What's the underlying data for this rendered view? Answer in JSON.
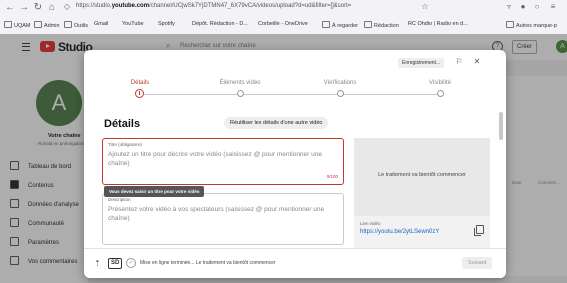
{
  "browser": {
    "url_prefix": "https://studio.",
    "url_domain": "youtube.com",
    "url_path": "/channel/UCjwSk7YjDTMN47_6X79vCA/videos/upload?d=ud&filter=[]&sort=",
    "bookmarks": [
      "UQAM",
      "Admin",
      "Outils",
      "Gmail",
      "YouTube",
      "Spotify",
      "Dépôt. Rédaction - D...",
      "Corbeille - OneDrive",
      "À regarder",
      "Rédaction",
      "RC Ohdio | Radio en d...",
      "Autres marque-p"
    ]
  },
  "studio": {
    "logo": "Studio",
    "search_placeholder": "Rechercher sur votre chaîne",
    "create_label": "Créer",
    "avatar_letter": "A",
    "channel_name": "Votre chaîne",
    "channel_sub": "Ronald en prolongation",
    "sidebar": [
      "Tableau de bord",
      "Contenus",
      "Données d'analyse",
      "Communauté",
      "Paramètres",
      "Vos commentaires"
    ],
    "right_panel_cols": [
      "Date",
      "Commen..."
    ]
  },
  "modal": {
    "draft_label": "Enregistrement...",
    "steps": [
      "Détails",
      "Éléments vidéo",
      "Vérifications",
      "Visibilité"
    ],
    "active_step": 0,
    "section_title": "Détails",
    "reuse_label": "Réutiliser les détails d'une autre vidéo",
    "title_field": {
      "label": "Titre (obligatoire)",
      "placeholder": "Ajoutez un titre pour décrire votre vidéo (saisissez @ pour mentionner une chaîne)",
      "count": "0/100"
    },
    "tooltip": "Vous devez saisir un titre pour votre vidéo",
    "description_field": {
      "label": "Description",
      "placeholder": "Présentez votre vidéo à vos spectateurs (saisissez @ pour mentionner une chaîne)"
    },
    "thumbnail_text": "Le traitement va bientôt commencer",
    "link_label": "Lien vidéo",
    "link_url": "https://youtu.be/2ytLSewn0zY",
    "footer_hd": "SD",
    "footer_status": "Mise en ligne terminée... Le traitement va bientôt commencer",
    "next_label": "Suivant"
  }
}
